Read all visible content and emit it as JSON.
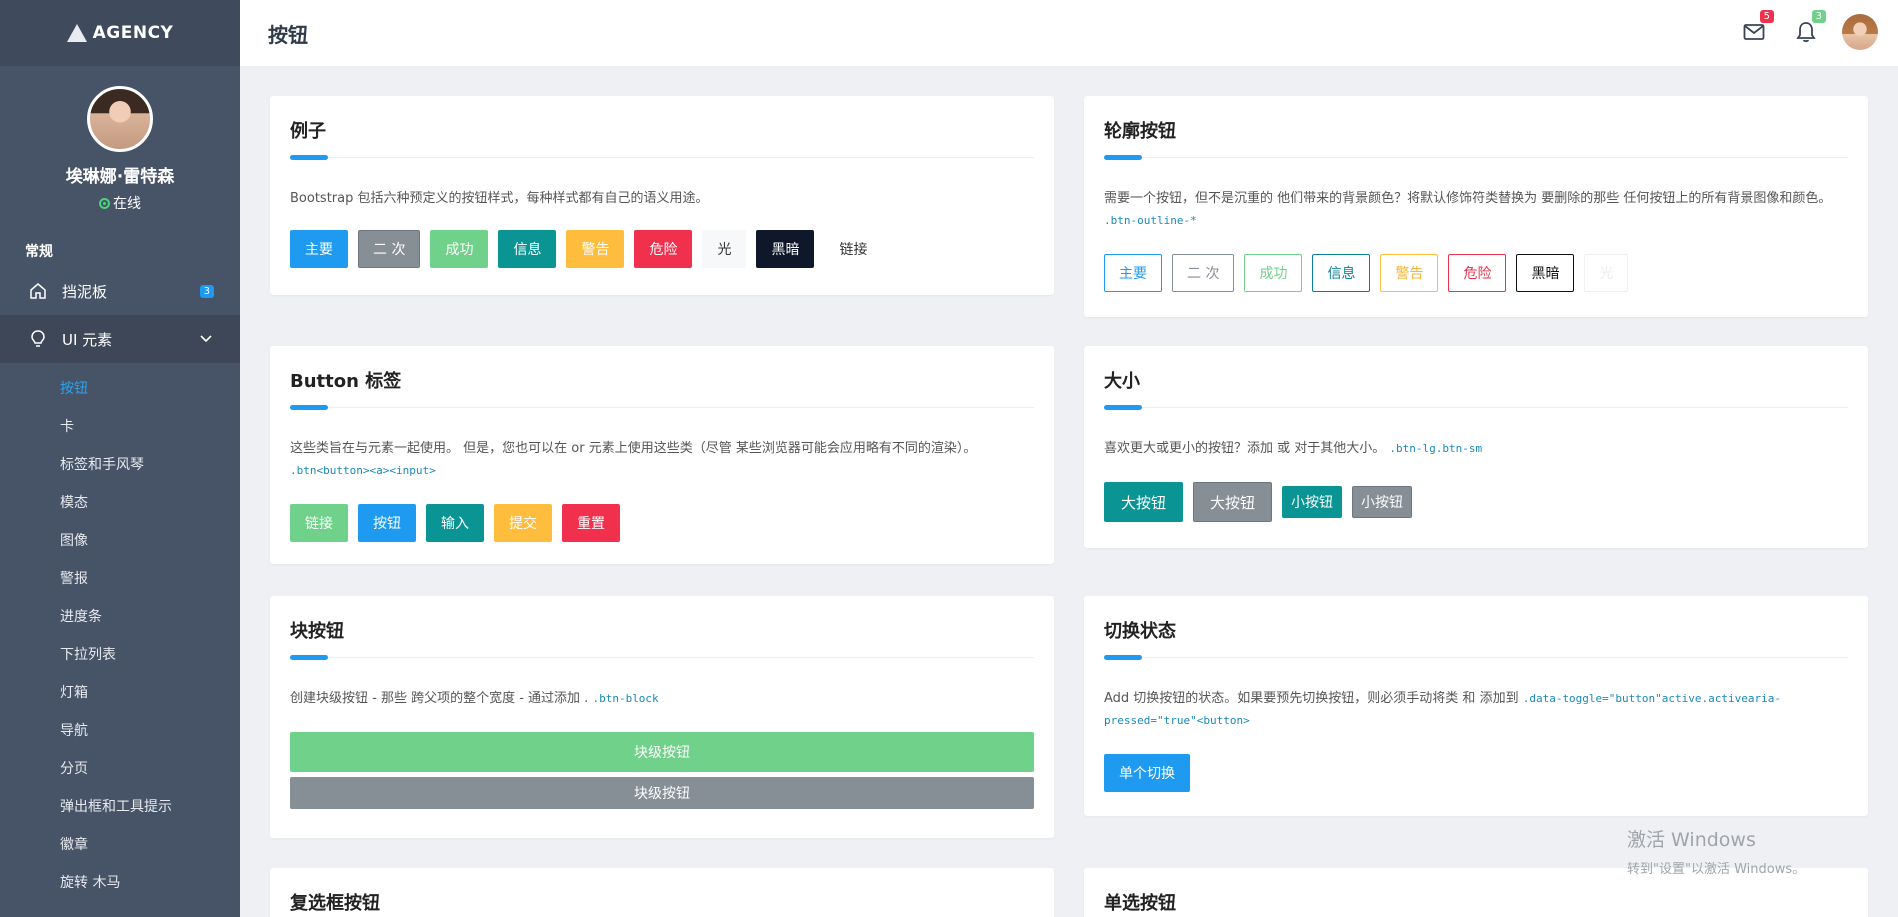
{
  "brand": {
    "name": "AGENCY"
  },
  "profile": {
    "name": "埃琳娜·雷特森",
    "status": "在线"
  },
  "nav": {
    "section": "常规",
    "dashboard": {
      "label": "挡泥板",
      "badge": "3"
    },
    "ui": {
      "label": "UI 元素"
    },
    "sub_items": [
      "按钮",
      "卡",
      "标签和手风琴",
      "模态",
      "图像",
      "警报",
      "进度条",
      "下拉列表",
      "灯箱",
      "导航",
      "分页",
      "弹出框和工具提示",
      "徽章",
      "旋转 木马"
    ]
  },
  "header": {
    "title": "按钮",
    "mail_badge": "5",
    "bell_badge": "3"
  },
  "colors": {
    "primary": "#1e9bf0",
    "sidebar": "#475467",
    "success": "#6fd18a",
    "danger": "#f0304c",
    "warning": "#ffbd3d",
    "info": "#0a9494"
  },
  "examples": {
    "title": "例子",
    "desc": "Bootstrap 包括六种预定义的按钮样式，每种样式都有自己的语义用途。",
    "buttons": [
      "主要",
      "二 次",
      "成功",
      "信息",
      "警告",
      "危险",
      "光",
      "黑暗",
      "链接"
    ]
  },
  "outline": {
    "title": "轮廓按钮",
    "desc": "需要一个按钮，但不是沉重的 他们带来的背景颜色？将默认修饰符类替换为 要删除的那些 任何按钮上的所有背景图像和颜色。",
    "code": ".btn-outline-*",
    "buttons": [
      "主要",
      "二 次",
      "成功",
      "信息",
      "警告",
      "危险",
      "黑暗",
      "光"
    ]
  },
  "tags": {
    "title": "Button 标签",
    "desc": "这些类旨在与元素一起使用。 但是，您也可以在 or 元素上使用这些类（尽管 某些浏览器可能会应用略有不同的渲染）。",
    "code": ".btn<button><a><input>",
    "buttons": [
      "链接",
      "按钮",
      "输入",
      "提交",
      "重置"
    ]
  },
  "sizes": {
    "title": "大小",
    "desc": "喜欢更大或更小的按钮？添加 或 对于其他大小。",
    "code": ".btn-lg.btn-sm",
    "buttons": [
      "大按钮",
      "大按钮",
      "小按钮",
      "小按钮"
    ]
  },
  "block": {
    "title": "块按钮",
    "desc": "创建块级按钮 - 那些 跨父项的整个宽度 - 通过添加 .",
    "code": ".btn-block",
    "buttons": [
      "块级按钮",
      "块级按钮"
    ]
  },
  "toggle": {
    "title": "切换状态",
    "desc": "Add 切换按钮的状态。如果要预先切换按钮，则必须手动将类 和 添加到 ",
    "code": ".data-toggle=\"button\"active.activearia-pressed=\"true\"<button>",
    "button": "单个切换"
  },
  "checkbox": {
    "title": "复选框按钮"
  },
  "radio": {
    "title": "单选按钮"
  },
  "watermark": {
    "line1": "激活 Windows",
    "line2": "转到\"设置\"以激活 Windows。"
  }
}
